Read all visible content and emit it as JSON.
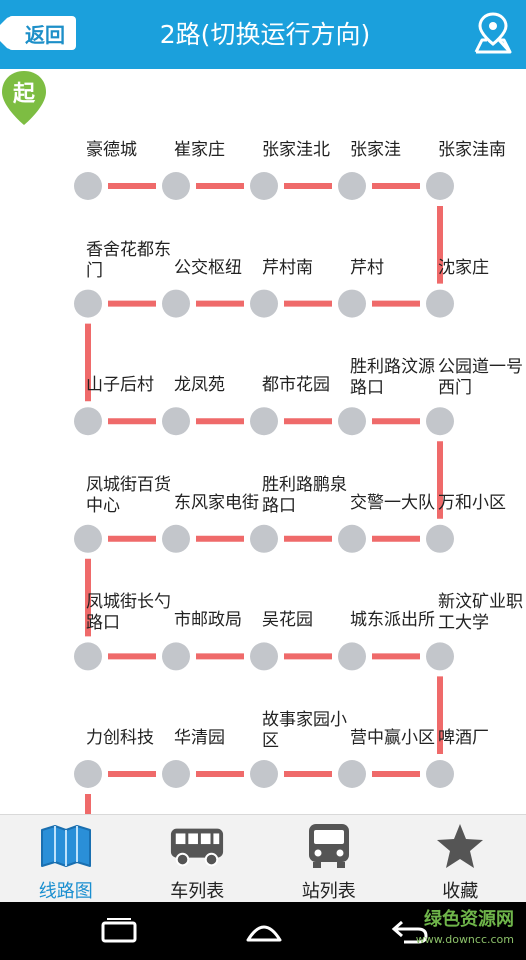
{
  "header": {
    "back_label": "返回",
    "title": "2路(切换运行方向)",
    "accent": "#1ba0dc"
  },
  "route": {
    "line_color": "#ef6a6a",
    "stop_color": "#c3c6cb",
    "start_label": "起",
    "start_color": "#7dbd42",
    "stops": [
      "豪德城",
      "崔家庄",
      "张家洼北",
      "张家洼",
      "张家洼南",
      "沈家庄",
      "芹村",
      "芹村南",
      "公交枢纽",
      "香舍花都东门",
      "山子后村",
      "龙凤苑",
      "都市花园",
      "胜利路汶源路口",
      "公园道一号西门",
      "万和小区",
      "交警一大队",
      "胜利路鹏泉路口",
      "东风家电街",
      "凤城街百货中心",
      "凤城街长勺路口",
      "市邮政局",
      "吴花园",
      "城东派出所",
      "新汶矿业职工大学",
      "啤酒厂",
      "营中赢小区",
      "故事家园小区",
      "华清园",
      "力创科技"
    ]
  },
  "tabs": [
    {
      "label": "线路图",
      "icon": "map-icon"
    },
    {
      "label": "车列表",
      "icon": "bus-icon"
    },
    {
      "label": "站列表",
      "icon": "bus-stop-icon"
    },
    {
      "label": "收藏",
      "icon": "star-icon"
    }
  ],
  "active_tab": "线路图",
  "watermark": {
    "text": "绿色资源网",
    "url": "www.downcc.com"
  }
}
